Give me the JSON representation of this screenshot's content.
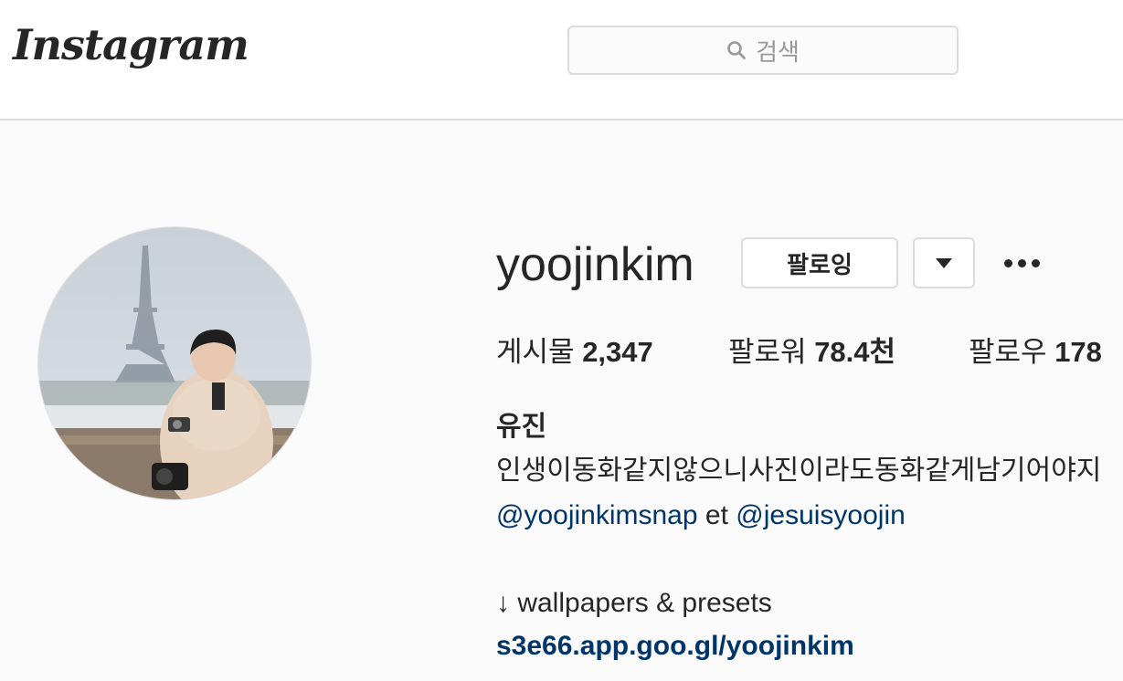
{
  "header": {
    "logo_text": "Instagram",
    "search_placeholder": "검색"
  },
  "profile": {
    "username": "yoojinkim",
    "follow_label": "팔로잉",
    "stats": {
      "posts_label": "게시물",
      "posts_value": "2,347",
      "followers_label": "팔로워",
      "followers_value": "78.4천",
      "following_label": "팔로우",
      "following_value": "178"
    },
    "full_name": "유진",
    "bio_line1": "인생이동화같지않으니사진이라도동화같게남기어야지",
    "bio_mention1": "@yoojinkimsnap",
    "bio_conjunction": "et",
    "bio_mention2": "@jesuisyoojin",
    "bio_line3": "↓ wallpapers & presets",
    "website": "s3e66.app.goo.gl/yoojinkim"
  },
  "colors": {
    "link": "#003569",
    "border": "#dbdbdb",
    "background": "#fafafa"
  }
}
